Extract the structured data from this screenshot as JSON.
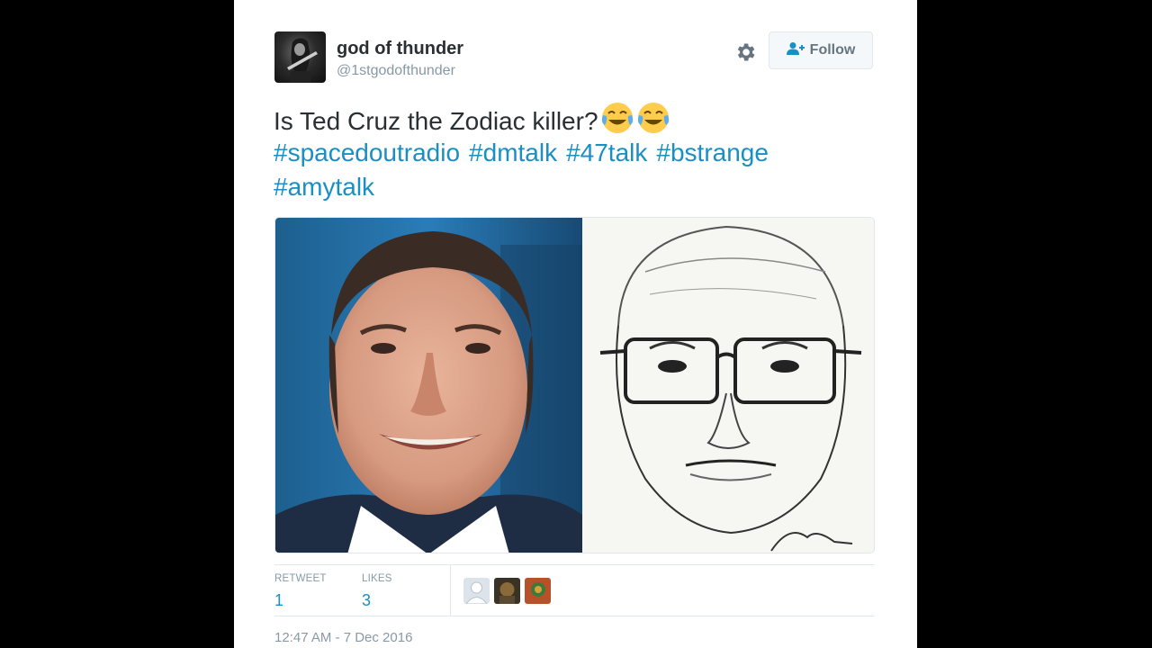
{
  "user": {
    "name": "god of thunder",
    "handle": "@1stgodofthunder"
  },
  "follow_button": {
    "label": "Follow"
  },
  "tweet": {
    "text": "Is Ted Cruz the Zodiac killer?",
    "emojis": [
      "face-with-tears-of-joy-icon",
      "face-with-tears-of-joy-icon"
    ],
    "hashtags": [
      "#spacedoutradio",
      "#dmtalk",
      "#47talk",
      "#bstrange",
      "#amytalk"
    ]
  },
  "stats": {
    "retweet_label": "RETWEET",
    "retweet_count": "1",
    "likes_label": "LIKES",
    "likes_count": "3"
  },
  "timestamp": "12:47 AM - 7 Dec 2016",
  "colors": {
    "link": "#1a8fc4",
    "text": "#292f33",
    "muted": "#8899a6"
  }
}
